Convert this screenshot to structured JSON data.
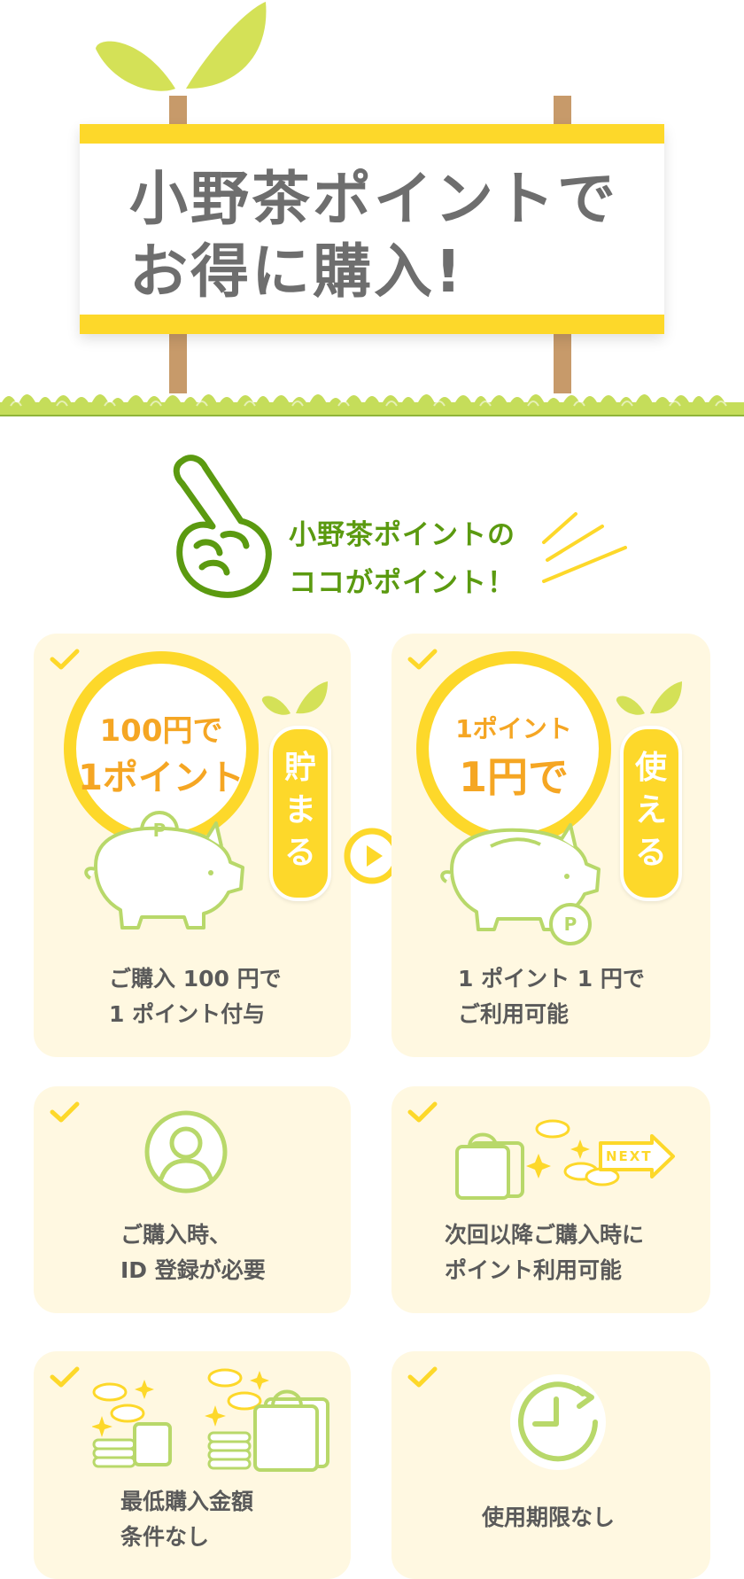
{
  "hero": {
    "title_line1": "小野茶ポイントで",
    "title_line2": "お得に購入!"
  },
  "intro": {
    "line1": "小野茶ポイントの",
    "line2": "ココがポイント！"
  },
  "cards": [
    {
      "coin_line1": "100円で",
      "coin_line2": "1ポイント",
      "bubble": "貯まる",
      "text_line1": "ご購入 100 円で",
      "text_line2": "1 ポイント付与"
    },
    {
      "coin_line1": "1ポイント",
      "coin_line2": "1円で",
      "bubble": "使える",
      "text_line1": "1 ポイント 1 円で",
      "text_line2": "ご利用可能"
    },
    {
      "text_line1": "ご購入時、",
      "text_line2": "ID 登録が必要"
    },
    {
      "next_label": "NEXT",
      "text_line1": "次回以降ご購入時に",
      "text_line2": "ポイント利用可能"
    },
    {
      "text_line1": "最低購入金額",
      "text_line2": "条件なし"
    },
    {
      "text_line1": "使用期限なし"
    }
  ],
  "icons": {
    "check": "check-icon",
    "user": "user-icon",
    "clock": "clock-icon",
    "piggy": "piggy-bank-icon",
    "pointing_hand": "pointing-hand-icon",
    "play": "play-circle-icon"
  },
  "colors": {
    "accent_yellow": "#fdd82a",
    "leaf_green": "#d4e157",
    "line_green": "#b8d86a",
    "text_green": "#5b9a10",
    "coin_orange": "#f5a623",
    "card_bg": "#fff8e1"
  }
}
